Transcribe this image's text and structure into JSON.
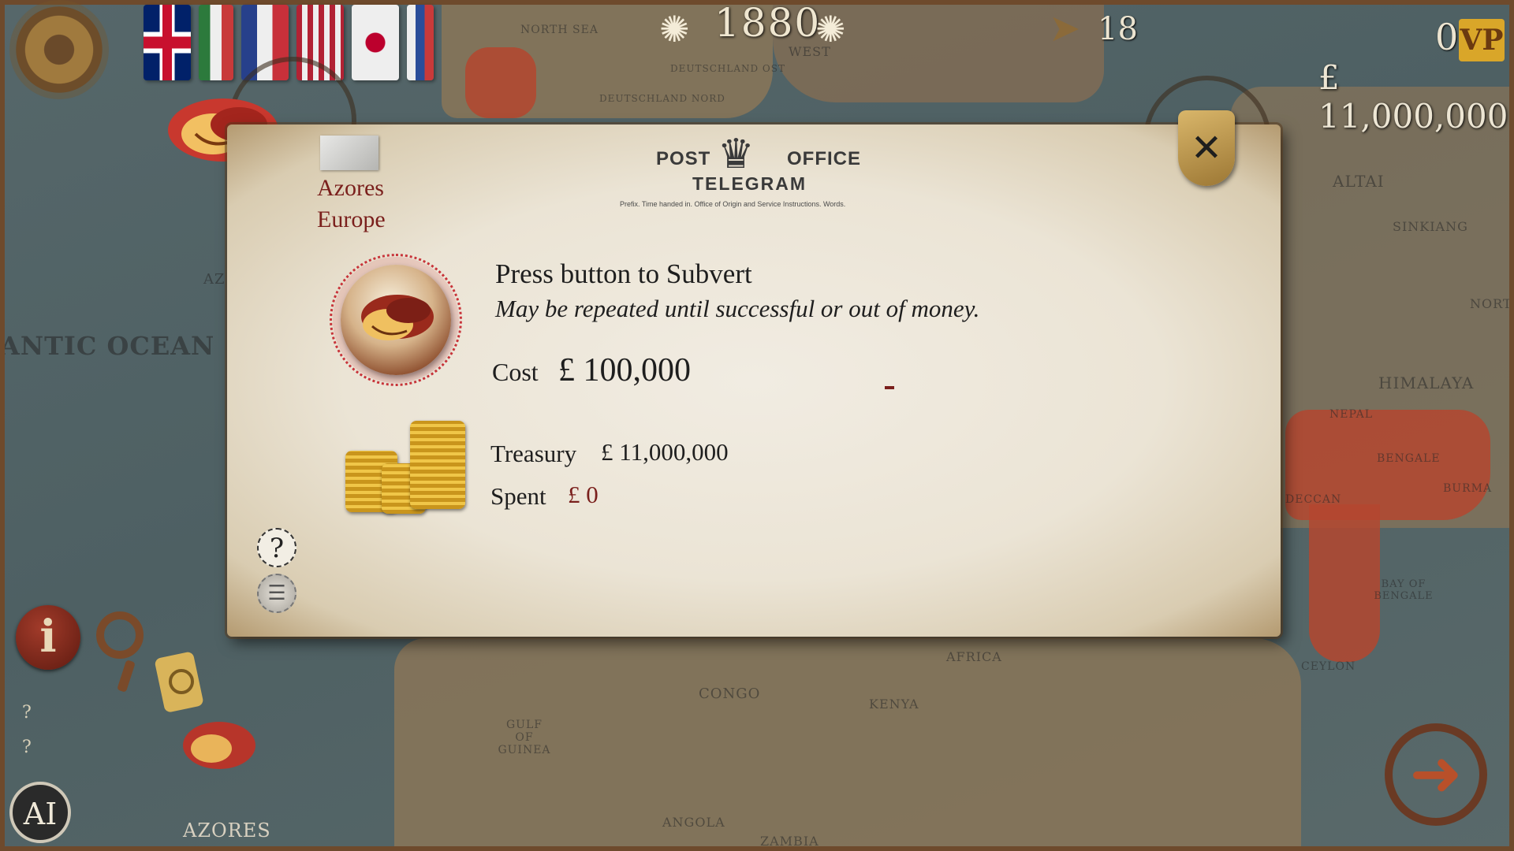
{
  "top_bar": {
    "year": "1880",
    "turn": "18",
    "victory_points": "0",
    "vp_badge": "VP",
    "money": "£ 11,000,000",
    "flags": [
      "uk-flag-icon",
      "italy-flag-icon",
      "france-flag-icon",
      "usa-flag-icon",
      "japan-flag-icon",
      "russia-flag-icon"
    ]
  },
  "map_labels": {
    "ocean": "ANTIC OCEAN",
    "north_sea": "NORTH SEA",
    "altai": "ALTAI",
    "sinkiang": "SINKIANG",
    "himalaya": "HIMALAYA",
    "nepal": "NEPAL",
    "bengale": "BENGALE",
    "burma": "BURMA",
    "deccan": "DECCAN",
    "bay_of_bengale": "BAY OF BENGALE",
    "ceylon": "CEYLON",
    "africa": "AFRICA",
    "congo": "CONGO",
    "kenya": "KENYA",
    "angola": "ANGOLA",
    "zambia": "ZAMBIA",
    "gulf_of_guinea": "GULF OF GUINEA",
    "deutschland_ost": "DEUTSCHLAND OST",
    "deutschland_nord": "DEUTSCHLAND NORD",
    "west": "WEST",
    "az": "AZ",
    "nort": "NORT"
  },
  "dialog": {
    "region_name": "Azores",
    "region_continent": "Europe",
    "post": "POST",
    "office": "OFFICE",
    "telegram": "TELEGRAM",
    "prefix_line": "Prefix.   Time handed in.   Office of Origin and Service Instructions.   Words.",
    "instruction_title": "Press button to Subvert",
    "instruction_subtitle": "May be repeated until successful or out of money.",
    "cost_label": "Cost",
    "cost_value": "£ 100,000",
    "treasury_label": "Treasury",
    "treasury_value": "£ 11,000,000",
    "spent_label": "Spent",
    "spent_value": "£ 0",
    "help_symbol": "?",
    "close_symbol": "✕"
  },
  "bottom": {
    "region_label": "AZORES",
    "ai_label": "AI",
    "info_symbol": "i",
    "question_marks": [
      "?",
      "?"
    ]
  },
  "colors": {
    "accent_red": "#7a1f1c",
    "parchment": "#ebe4d5",
    "gold": "#d9a629",
    "map_sea": "#56676a"
  }
}
